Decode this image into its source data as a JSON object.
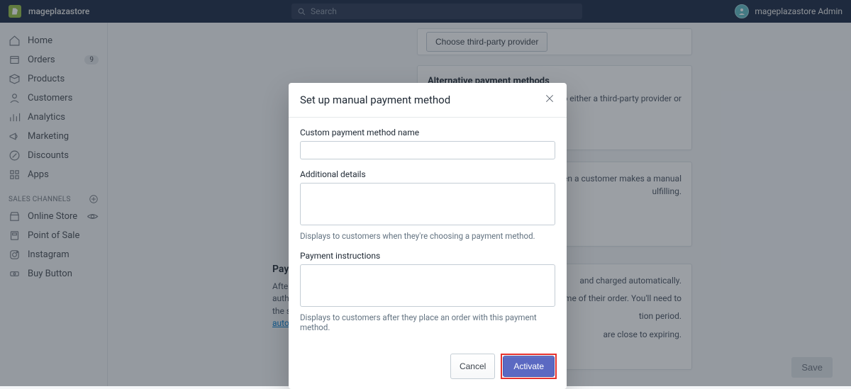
{
  "topbar": {
    "store_name": "mageplazastore",
    "search_placeholder": "Search",
    "admin_label": "mageplazastore Admin"
  },
  "sidebar": {
    "items": [
      {
        "label": "Home"
      },
      {
        "label": "Orders",
        "badge": "9"
      },
      {
        "label": "Products"
      },
      {
        "label": "Customers"
      },
      {
        "label": "Analytics"
      },
      {
        "label": "Marketing"
      },
      {
        "label": "Discounts"
      },
      {
        "label": "Apps"
      }
    ],
    "section_label": "SALES CHANNELS",
    "channels": [
      {
        "label": "Online Store"
      },
      {
        "label": "Point of Sale"
      },
      {
        "label": "Instagram"
      },
      {
        "label": "Buy Button"
      }
    ]
  },
  "background": {
    "choose_provider_btn": "Choose third-party provider",
    "alt_heading": "Alternative payment methods",
    "alt_text_fragment": "tion to either a third-party provider or",
    "manual_text_fragment1": "ore. When a customer makes a manual",
    "manual_text_fragment2": "ulfilling.",
    "left_heading": "Paym",
    "left_p1": "After a",
    "left_p2": "autho",
    "left_p3": "the sa",
    "left_link": "autom",
    "capture_p1": "and charged automatically.",
    "capture_p2": "at the time of their order. You'll need to",
    "capture_p3": "tion period.",
    "capture_p4": "are close to expiring.",
    "save_btn": "Save"
  },
  "modal": {
    "title": "Set up manual payment method",
    "name_label": "Custom payment method name",
    "details_label": "Additional details",
    "details_help": "Displays to customers when they're choosing a payment method.",
    "instructions_label": "Payment instructions",
    "instructions_help": "Displays to customers after they place an order with this payment method.",
    "cancel_btn": "Cancel",
    "activate_btn": "Activate"
  }
}
